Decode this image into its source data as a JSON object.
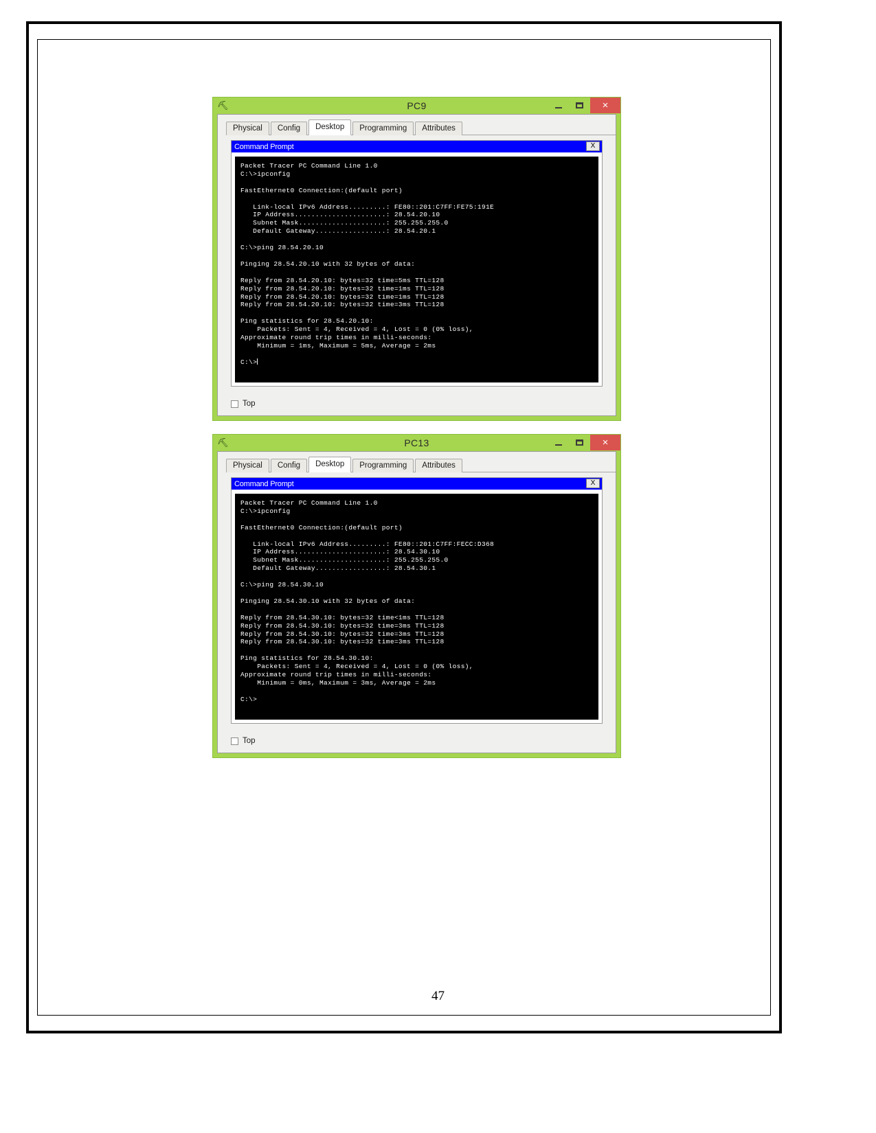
{
  "document": {
    "page_number": "47"
  },
  "windows": [
    {
      "title": "PC9",
      "icon": "packet-tracer-pc-icon",
      "controls": {
        "minimize": "–",
        "maximize": "□",
        "close": "×"
      },
      "tabs": [
        {
          "label": "Physical",
          "active": false
        },
        {
          "label": "Config",
          "active": false
        },
        {
          "label": "Desktop",
          "active": true
        },
        {
          "label": "Programming",
          "active": false
        },
        {
          "label": "Attributes",
          "active": false
        }
      ],
      "command_prompt": {
        "title": "Command Prompt",
        "close_label": "X",
        "terminal_text": "Packet Tracer PC Command Line 1.0\nC:\\>ipconfig\n\nFastEthernet0 Connection:(default port)\n\n   Link-local IPv6 Address.........: FE80::201:C7FF:FE75:191E\n   IP Address......................: 28.54.20.10\n   Subnet Mask.....................: 255.255.255.0\n   Default Gateway.................: 28.54.20.1\n\nC:\\>ping 28.54.20.10\n\nPinging 28.54.20.10 with 32 bytes of data:\n\nReply from 28.54.20.10: bytes=32 time=5ms TTL=128\nReply from 28.54.20.10: bytes=32 time=1ms TTL=128\nReply from 28.54.20.10: bytes=32 time=1ms TTL=128\nReply from 28.54.20.10: bytes=32 time=3ms TTL=128\n\nPing statistics for 28.54.20.10:\n    Packets: Sent = 4, Received = 4, Lost = 0 (0% loss),\nApproximate round trip times in milli-seconds:\n    Minimum = 1ms, Maximum = 5ms, Average = 2ms\n\nC:\\>"
      },
      "bottom": {
        "checkbox_label": "Top",
        "checked": false
      }
    },
    {
      "title": "PC13",
      "icon": "packet-tracer-pc-icon",
      "controls": {
        "minimize": "–",
        "maximize": "□",
        "close": "×"
      },
      "tabs": [
        {
          "label": "Physical",
          "active": false
        },
        {
          "label": "Config",
          "active": false
        },
        {
          "label": "Desktop",
          "active": true
        },
        {
          "label": "Programming",
          "active": false
        },
        {
          "label": "Attributes",
          "active": false
        }
      ],
      "command_prompt": {
        "title": "Command Prompt",
        "close_label": "X",
        "terminal_text": "Packet Tracer PC Command Line 1.0\nC:\\>ipconfig\n\nFastEthernet0 Connection:(default port)\n\n   Link-local IPv6 Address.........: FE80::201:C7FF:FECC:D368\n   IP Address......................: 28.54.30.10\n   Subnet Mask.....................: 255.255.255.0\n   Default Gateway.................: 28.54.30.1\n\nC:\\>ping 28.54.30.10\n\nPinging 28.54.30.10 with 32 bytes of data:\n\nReply from 28.54.30.10: bytes=32 time<1ms TTL=128\nReply from 28.54.30.10: bytes=32 time=3ms TTL=128\nReply from 28.54.30.10: bytes=32 time=3ms TTL=128\nReply from 28.54.30.10: bytes=32 time=3ms TTL=128\n\nPing statistics for 28.54.30.10:\n    Packets: Sent = 4, Received = 4, Lost = 0 (0% loss),\nApproximate round trip times in milli-seconds:\n    Minimum = 0ms, Maximum = 3ms, Average = 2ms\n\nC:\\>"
      },
      "bottom": {
        "checkbox_label": "Top",
        "checked": false
      }
    }
  ],
  "colors": {
    "window_chrome": "#a6d54f",
    "close_button": "#d9534f",
    "cmd_titlebar": "#0000ff",
    "terminal_bg": "#000000",
    "terminal_fg": "#ffffff"
  }
}
